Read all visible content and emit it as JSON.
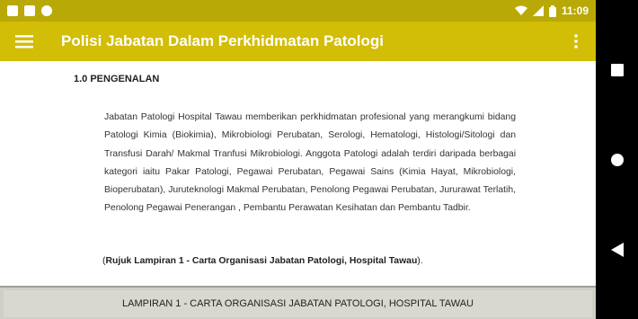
{
  "status_bar": {
    "time": "11:09",
    "icons": [
      "notification-icon",
      "sd-card-icon",
      "sync-icon",
      "wifi-icon",
      "signal-icon",
      "battery-icon"
    ]
  },
  "app_bar": {
    "title": "Polisi Jabatan Dalam Perkhidmatan Patologi",
    "menu_icon": "hamburger-menu-icon",
    "more_icon": "more-vert-icon"
  },
  "content": {
    "heading": "1.0 PENGENALAN",
    "paragraph": "Jabatan Patologi Hospital Tawau memberikan perkhidmatan profesional yang merangkumi bidang Patologi Kimia (Biokimia), Mikrobiologi Perubatan, Serologi, Hematologi, Histologi/Sitologi dan Transfusi Darah/ Makmal Tranfusi Mikrobiologi. Anggota Patologi adalah terdiri daripada berbagai kategori iaitu Pakar Patologi, Pegawai Perubatan, Pegawai Sains (Kimia Hayat, Mikrobiologi, Bioperubatan), Juruteknologi Makmal Perubatan, Penolong Pegawai Perubatan, Jururawat Terlatih, Penolong Pegawai Penerangan , Pembantu Perawatan Kesihatan dan Pembantu Tadbir.",
    "reference_open": "(",
    "reference_bold": "Rujuk Lampiran 1 - Carta Organisasi Jabatan Patologi, Hospital Tawau",
    "reference_close": ")."
  },
  "footer": {
    "button_label": "LAMPIRAN 1 - CARTA ORGANISASI JABATAN PATOLOGI, HOSPITAL TAWAU"
  },
  "nav_bar": {
    "buttons": [
      "recents-icon",
      "home-icon",
      "back-icon"
    ]
  },
  "colors": {
    "status_bar": "#b9a906",
    "app_bar": "#d2bd07",
    "footer": "#d8d8d0"
  }
}
